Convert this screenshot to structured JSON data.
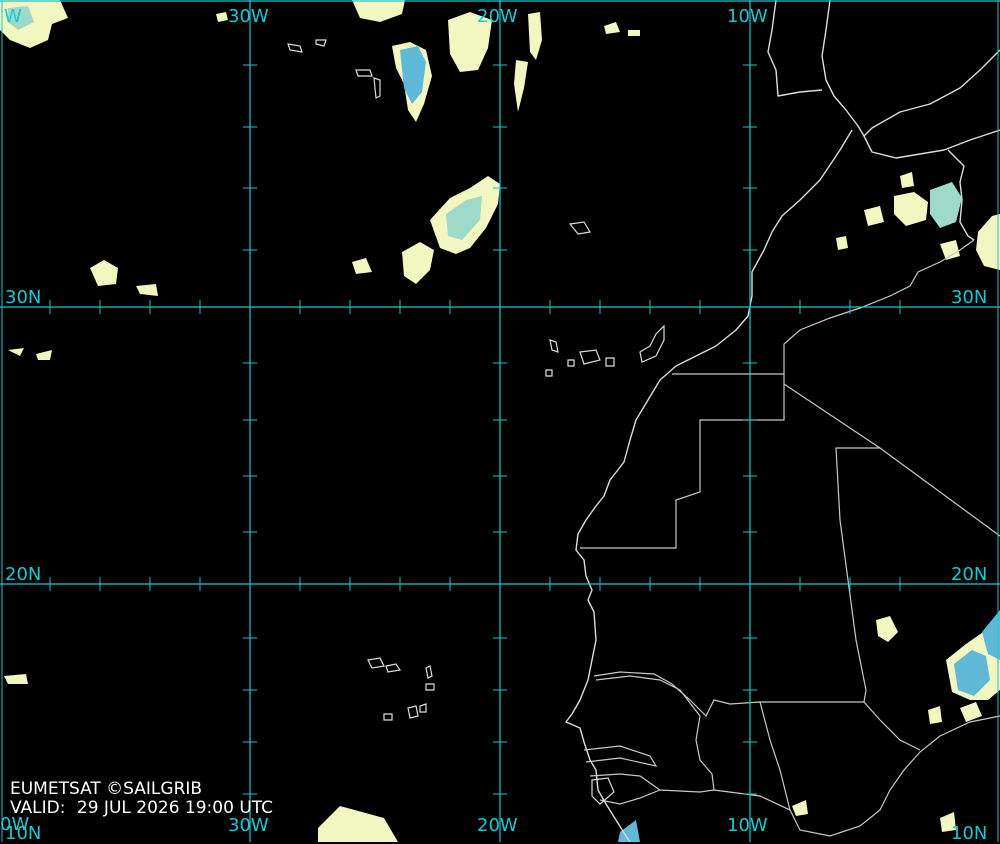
{
  "grid_labels": {
    "lon_top": [
      "30W",
      "20W",
      "10W"
    ],
    "lon_top_partial": "W",
    "lon_bottom": [
      "30W",
      "20W",
      "10W"
    ],
    "lon_bottom_partial": "0W",
    "lat_left": [
      "30N",
      "20N"
    ],
    "lat_left_partial": "10N",
    "lat_right": [
      "30N",
      "20N",
      "10N"
    ]
  },
  "credit": {
    "source": "EUMETSAT ©SAILGRIB",
    "valid_label": "VALID:",
    "valid_time": "29 JUL 2026 19:00 UTC"
  },
  "colors": {
    "grid": "#19c8d2",
    "coastline": "#dcdcdc",
    "background": "#000000",
    "cloud_light": "#f2f6c0",
    "cloud_mid": "#9fd9c9",
    "cloud_high": "#5fb8d6"
  }
}
